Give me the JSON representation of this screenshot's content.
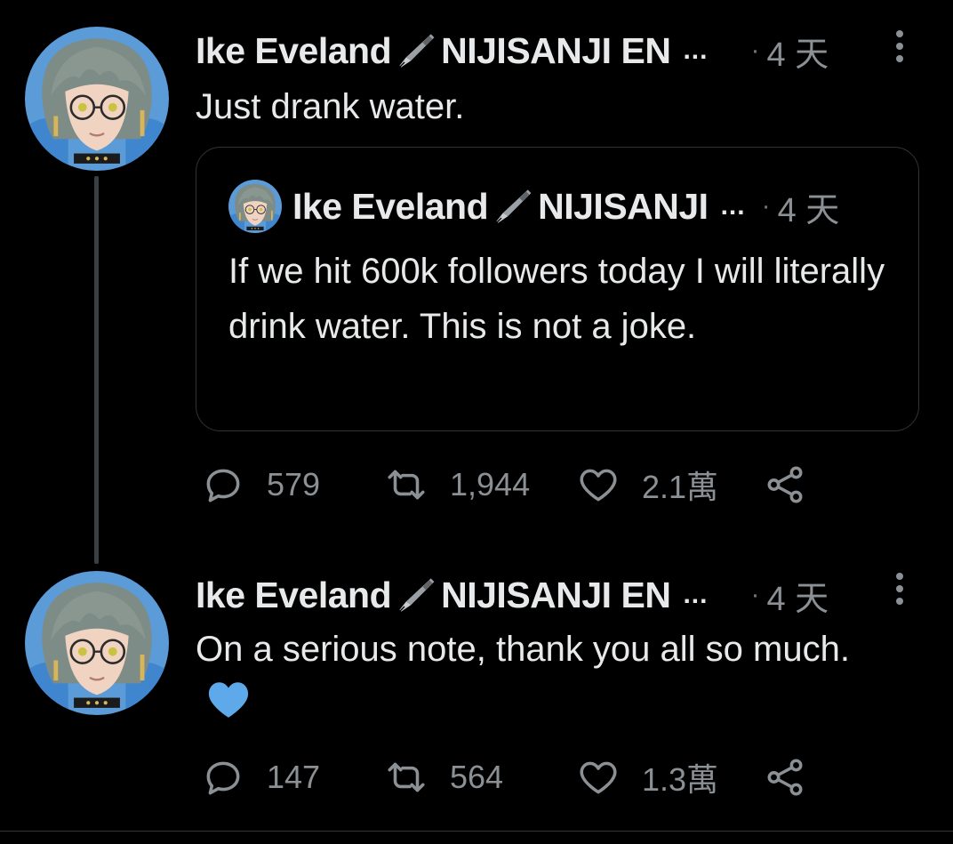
{
  "tweets": [
    {
      "author": "Ike Eveland",
      "author_suffix": "NIJISANJI EN",
      "ellipsis": "...",
      "dot": "·",
      "time": "4 天",
      "text": "Just drank water.",
      "quote": {
        "author": "Ike Eveland",
        "author_suffix": "NIJISANJI",
        "ellipsis": "...",
        "dot": "·",
        "time": "4 天",
        "text": "If we hit 600k followers today I will literally drink water. This is not a joke."
      },
      "actions": {
        "replies": "579",
        "retweets": "1,944",
        "likes": "2.1萬"
      }
    },
    {
      "author": "Ike Eveland",
      "author_suffix": "NIJISANJI EN",
      "ellipsis": "...",
      "dot": "·",
      "time": "4 天",
      "text": "On a serious note, thank you all so much.",
      "emoji": "blue-heart",
      "actions": {
        "replies": "147",
        "retweets": "564",
        "likes": "1.3萬"
      }
    }
  ],
  "icons": {
    "reply": "reply-icon",
    "retweet": "retweet-icon",
    "like": "heart-icon",
    "share": "share-icon",
    "more": "more-icon",
    "pen": "fountain-pen-icon"
  },
  "colors": {
    "background": "#000000",
    "text": "#e7e9ea",
    "muted": "#8b9095",
    "border": "#2f3336",
    "heart_emoji": "#5da9ea"
  }
}
